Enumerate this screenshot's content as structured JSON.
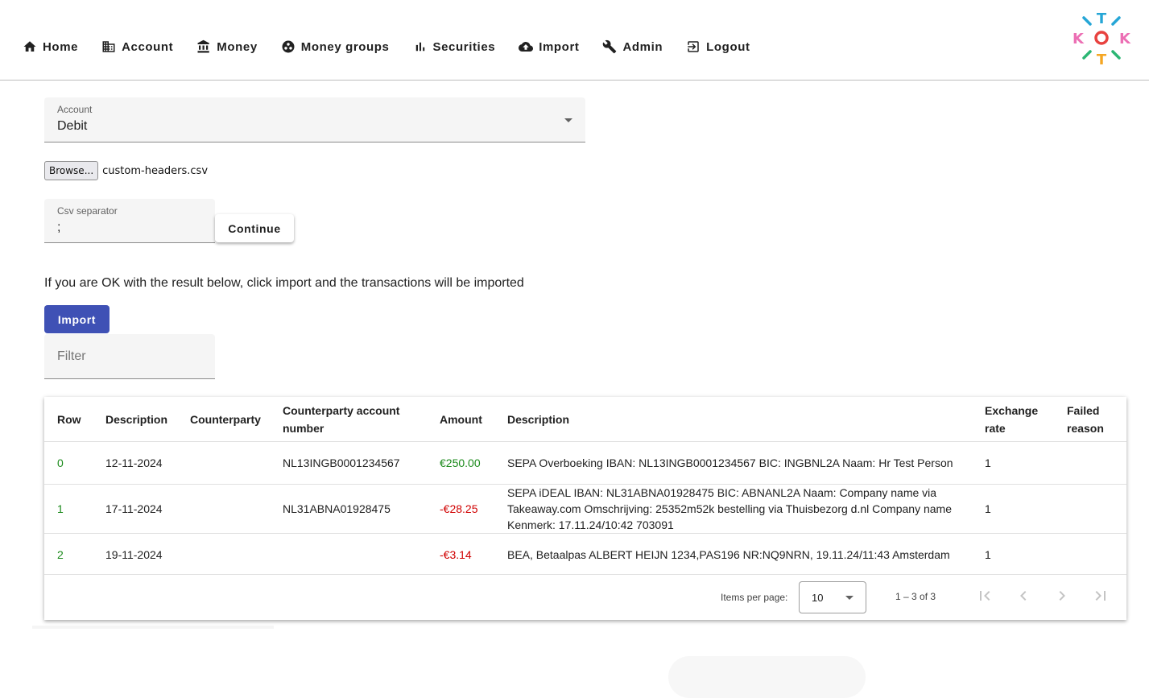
{
  "nav": {
    "items": [
      {
        "label": "Home",
        "icon": "home-icon"
      },
      {
        "label": "Account",
        "icon": "building-icon"
      },
      {
        "label": "Money",
        "icon": "bank-icon"
      },
      {
        "label": "Money groups",
        "icon": "groups-icon"
      },
      {
        "label": "Securities",
        "icon": "chart-icon"
      },
      {
        "label": "Import",
        "icon": "cloud-upload-icon"
      },
      {
        "label": "Admin",
        "icon": "wrench-icon"
      },
      {
        "label": "Logout",
        "icon": "logout-icon"
      }
    ]
  },
  "form": {
    "account_label": "Account",
    "account_value": "Debit",
    "browse_label": "Browse...",
    "file_name": "custom-headers.csv",
    "separator_label": "Csv separator",
    "separator_value": ";",
    "continue_label": "Continue",
    "info_text": "If you are OK with the result below, click import and the transactions will be imported",
    "import_label": "Import",
    "filter_placeholder": "Filter"
  },
  "table": {
    "headers": [
      "Row",
      "Description",
      "Counterparty",
      "Counterparty account number",
      "Amount",
      "Description",
      "Exchange rate",
      "Failed reason"
    ],
    "rows": [
      {
        "row": "0",
        "date": "12-11-2024",
        "counterparty": "",
        "account": "NL13INGB0001234567",
        "amount": "€250.00",
        "description": "SEPA Overboeking IBAN: NL13INGB0001234567 BIC: INGBNL2A Naam: Hr Test Person",
        "rate": "1",
        "failed": ""
      },
      {
        "row": "1",
        "date": "17-11-2024",
        "counterparty": "",
        "account": "NL31ABNA01928475",
        "amount": "-€28.25",
        "description": "SEPA iDEAL IBAN: NL31ABNA01928475 BIC: ABNANL2A Naam: Company name via Takeaway.com Omschrijving: 25352m52k bestelling via Thuisbezorg d.nl Company name Kenmerk: 17.11.24/10:42 703091",
        "rate": "1",
        "failed": ""
      },
      {
        "row": "2",
        "date": "19-11-2024",
        "counterparty": "",
        "account": "",
        "amount": "-€3.14",
        "description": "BEA, Betaalpas ALBERT HEIJN 1234,PAS196 NR:NQ9NRN, 19.11.24/11:43 Amsterdam",
        "rate": "1",
        "failed": ""
      }
    ]
  },
  "paginator": {
    "items_per_page_label": "Items per page:",
    "items_per_page": "10",
    "range": "1 – 3 of 3"
  },
  "colors": {
    "primary": "#3f51b5",
    "positive": "#1b8a1b",
    "negative": "#d00000"
  }
}
